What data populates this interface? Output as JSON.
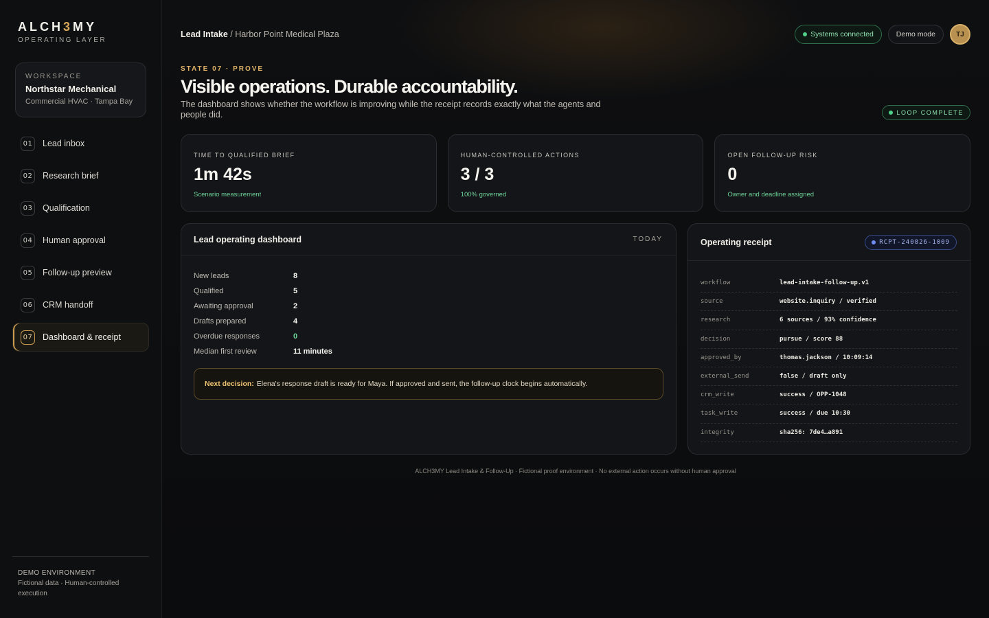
{
  "brand": {
    "name_prefix": "ALCH",
    "name_accent": "3",
    "name_suffix": "MY",
    "subtitle": "OPERATING LAYER"
  },
  "workspace": {
    "label": "WORKSPACE",
    "name": "Northstar Mechanical",
    "description": "Commercial HVAC · Tampa Bay"
  },
  "nav": {
    "items": [
      {
        "num": "01",
        "label": "Lead inbox"
      },
      {
        "num": "02",
        "label": "Research brief"
      },
      {
        "num": "03",
        "label": "Qualification"
      },
      {
        "num": "04",
        "label": "Human approval"
      },
      {
        "num": "05",
        "label": "Follow-up preview"
      },
      {
        "num": "06",
        "label": "CRM handoff"
      },
      {
        "num": "07",
        "label": "Dashboard & receipt"
      }
    ]
  },
  "sidebar_footer": {
    "title": "DEMO ENVIRONMENT",
    "description": "Fictional data · Human-controlled execution"
  },
  "header": {
    "crumb_primary": "Lead Intake",
    "crumb_separator": " / ",
    "crumb_secondary": "Harbor Point Medical Plaza",
    "status": "Systems connected",
    "mode": "Demo mode",
    "avatar": "TJ"
  },
  "hero": {
    "state": "STATE 07 · PROVE",
    "title": "Visible operations. Durable accountability.",
    "subtitle": "The dashboard shows whether the workflow is improving while the receipt records exactly what the agents and people did.",
    "badge": "LOOP COMPLETE"
  },
  "kpis": [
    {
      "label": "TIME TO QUALIFIED BRIEF",
      "value": "1m 42s",
      "note": "Scenario measurement"
    },
    {
      "label": "HUMAN-CONTROLLED ACTIONS",
      "value": "3 / 3",
      "note": "100% governed"
    },
    {
      "label": "OPEN FOLLOW-UP RISK",
      "value": "0",
      "note": "Owner and deadline assigned"
    }
  ],
  "dashboard": {
    "title": "Lead operating dashboard",
    "tag": "TODAY",
    "metrics": [
      {
        "key": "New leads",
        "value": "8"
      },
      {
        "key": "Qualified",
        "value": "5"
      },
      {
        "key": "Awaiting approval",
        "value": "2"
      },
      {
        "key": "Drafts prepared",
        "value": "4"
      },
      {
        "key": "Overdue responses",
        "value": "0"
      },
      {
        "key": "Median first review",
        "value": "11 minutes"
      }
    ],
    "decision_label": "Next decision:",
    "decision_text": "Elena's response draft is ready for Maya. If approved and sent, the follow-up clock begins automatically."
  },
  "receipt": {
    "title": "Operating receipt",
    "id": "RCPT-240826-1009",
    "rows": [
      {
        "key": "workflow",
        "value": "lead-intake-follow-up.v1"
      },
      {
        "key": "source",
        "value": "website.inquiry / verified"
      },
      {
        "key": "research",
        "value": "6 sources / 93% confidence"
      },
      {
        "key": "decision",
        "value": "pursue / score 88"
      },
      {
        "key": "approved_by",
        "value": "thomas.jackson / 10:09:14"
      },
      {
        "key": "external_send",
        "value": "false / draft only"
      },
      {
        "key": "crm_write",
        "value": "success / OPP-1048"
      },
      {
        "key": "task_write",
        "value": "success / due 10:30"
      },
      {
        "key": "integrity",
        "value": "sha256: 7de4…a891"
      }
    ]
  },
  "footer": {
    "note": "ALCH3MY Lead Intake & Follow-Up · Fictional proof environment · No external action occurs without human approval"
  },
  "colors": {
    "accent_gold": "#d6a75a",
    "status_green": "#6fd39a",
    "receipt_blue": "#aab9f2"
  }
}
